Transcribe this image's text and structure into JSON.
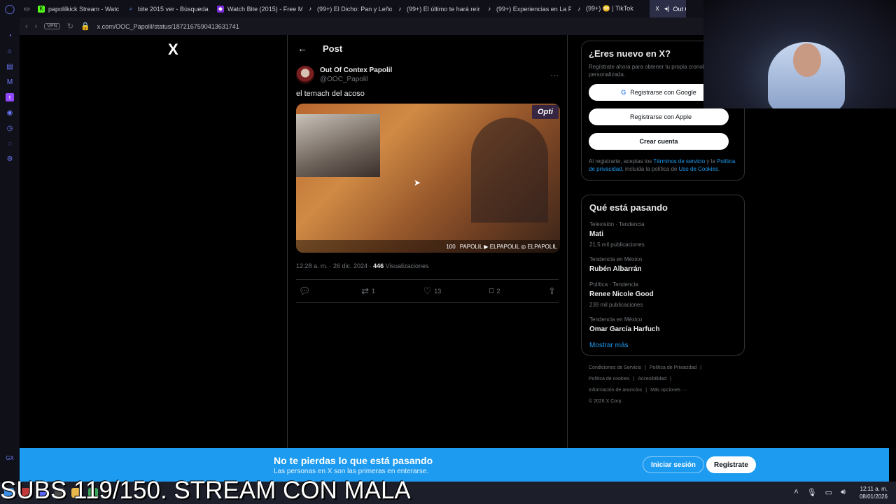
{
  "browser": {
    "tabs": [
      {
        "label": "papolilkick Stream - Watc",
        "fav_color": "#53fc18",
        "fav_glyph": "K"
      },
      {
        "label": "bite 2015 ver - Búsqueda",
        "fav_color": "#3a6bd6",
        "fav_glyph": "🔍"
      },
      {
        "label": "Watch Bite (2015) - Free M",
        "fav_color": "#7a2ad6",
        "fav_glyph": "◆"
      },
      {
        "label": "(99+) El Dicho: Pan y Leño",
        "fav_color": "#111111",
        "fav_glyph": "♪"
      },
      {
        "label": "(99+) El último te hará reír",
        "fav_color": "#111111",
        "fav_glyph": "♪"
      },
      {
        "label": "(99+) Experiencias en La P",
        "fav_color": "#111111",
        "fav_glyph": "♪"
      },
      {
        "label": "(99+) 😳 | TikTok",
        "fav_color": "#111111",
        "fav_glyph": "♪"
      },
      {
        "label": "Out C",
        "fav_color": "#000000",
        "fav_glyph": "X"
      }
    ],
    "url": "x.com/OOC_Papolil/status/1872167590413631741",
    "vpn_label": "VPN",
    "sidebar_bottom": "GX"
  },
  "page": {
    "logo": "X",
    "header_title": "Post",
    "author_name": "Out Of Contex Papolil",
    "author_handle": "@OOC_Papolil",
    "tweet_text": "el temach del acoso",
    "media": {
      "badge": "Opti",
      "hud_left": "100",
      "hud_social": "PAPOLIL ▶ ELPAPOLIL ◎ ELPAPOLIL"
    },
    "timestamp": "12:28 a. m. · 26 dic. 2024 · ",
    "views_count": "446",
    "views_label": "Visualizaciones",
    "actions": {
      "reply": "",
      "retweet": "1",
      "like": "13",
      "bookmark": "2"
    }
  },
  "signup_card": {
    "title": "¿Eres nuevo en X?",
    "subtitle": "Regístrate ahora para obtener tu propia cronología personalizada.",
    "google": "Registrarse con Google",
    "apple": "Registrarse con Apple",
    "create": "Crear cuenta",
    "legal_1": "Al registrarte, aceptas los ",
    "legal_terms": "Términos de servicio",
    "legal_2": " y la ",
    "legal_privacy": "Política de privacidad",
    "legal_3": ", incluida la política de ",
    "legal_cookies": "Uso de Cookies",
    "legal_4": "."
  },
  "trends": {
    "title": "Qué está pasando",
    "items": [
      {
        "context": "Televisión · Tendencia",
        "name": "Mati",
        "posts": "21,5 mil publicaciones"
      },
      {
        "context": "Tendencia en México",
        "name": "Rubén Albarrán",
        "posts": ""
      },
      {
        "context": "Política · Tendencia",
        "name": "Renee Nicole Good",
        "posts": "239 mil publicaciones"
      },
      {
        "context": "Tendencia en México",
        "name": "Omar García Harfuch",
        "posts": ""
      }
    ],
    "show_more": "Mostrar más"
  },
  "footer": {
    "links": [
      "Condiciones de Servicio",
      "|",
      "Política de Privacidad",
      "|",
      "Política de cookies",
      "|",
      "Accesibilidad",
      "|",
      "Información de anuncios",
      "|",
      "Más opciones ···"
    ],
    "copyright": "© 2026 X Corp."
  },
  "banner": {
    "title": "No te pierdas lo que está pasando",
    "subtitle": "Las personas en X son las primeras en enterarse.",
    "login": "Iniciar sesión",
    "register": "Regístrate"
  },
  "taskbar": {
    "overlay": "SUBS 119/150. STREAM CON MALA",
    "time": "12:11 a. m.",
    "date": "08/01/2026"
  }
}
